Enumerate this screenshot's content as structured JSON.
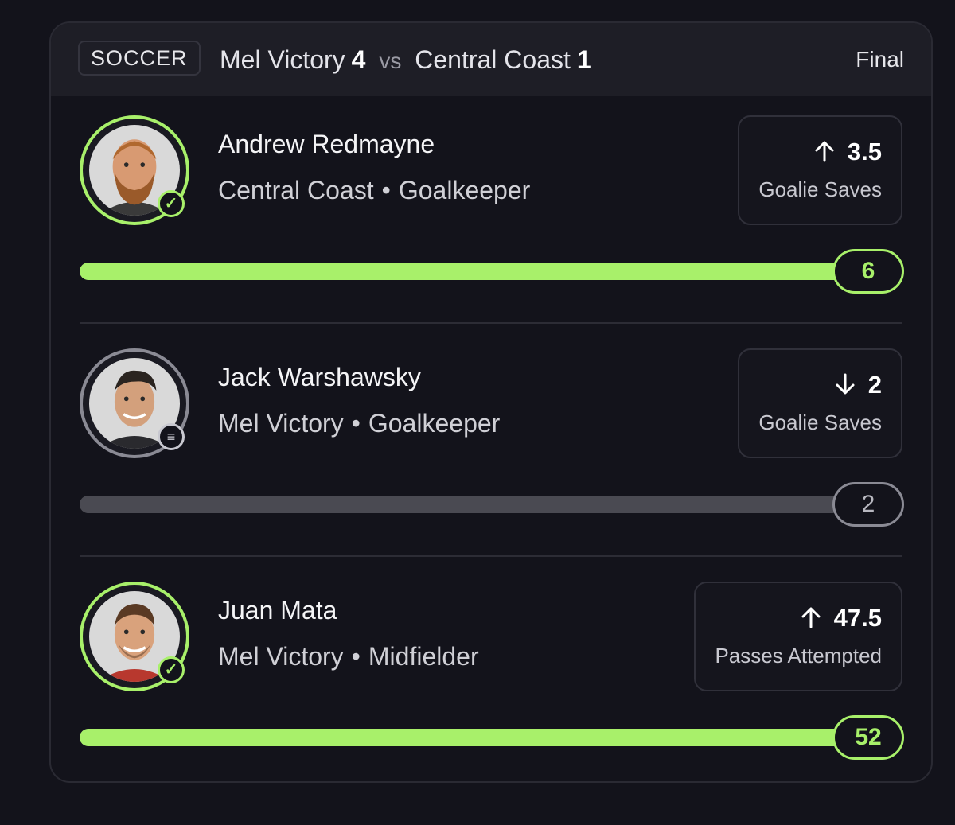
{
  "header": {
    "sport": "SOCCER",
    "home_team": "Mel Victory",
    "home_score": "4",
    "vs": "vs",
    "away_team": "Central Coast",
    "away_score": "1",
    "status": "Final"
  },
  "colors": {
    "accent": "#a8f06a",
    "neutral": "#8a8a94",
    "background": "#13131b",
    "header_bg": "#1e1e26"
  },
  "players": [
    {
      "name": "Andrew Redmayne",
      "team": "Central Coast",
      "separator": "•",
      "position": "Goalkeeper",
      "direction": "up",
      "line": "3.5",
      "stat": "Goalie Saves",
      "result": "6",
      "progress_fraction": 1.0,
      "status_icon": "check-icon",
      "status": "hit"
    },
    {
      "name": "Jack Warshawsky",
      "team": "Mel Victory",
      "separator": "•",
      "position": "Goalkeeper",
      "direction": "down",
      "line": "2",
      "stat": "Goalie Saves",
      "result": "2",
      "progress_fraction": 1.0,
      "status_icon": "push-icon",
      "status": "push"
    },
    {
      "name": "Juan Mata",
      "team": "Mel Victory",
      "separator": "•",
      "position": "Midfielder",
      "direction": "up",
      "line": "47.5",
      "stat": "Passes Attempted",
      "result": "52",
      "progress_fraction": 1.0,
      "status_icon": "check-icon",
      "status": "hit"
    }
  ]
}
